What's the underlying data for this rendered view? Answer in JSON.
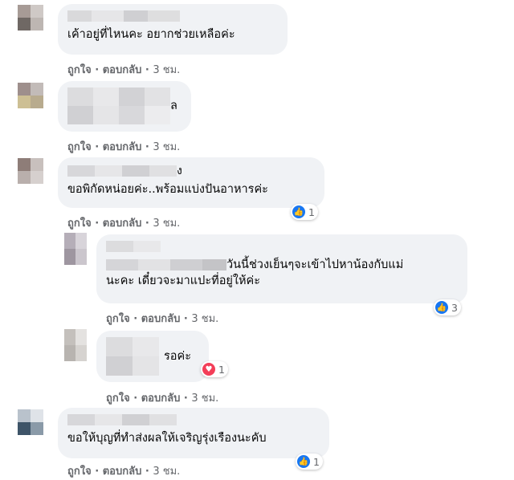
{
  "colors": {
    "bubble": "#f0f2f5",
    "meta": "#65676b",
    "like": "#1877f2",
    "love": "#f33e58"
  },
  "meta": {
    "like": "ถูกใจ",
    "reply": "ตอบกลับ",
    "sep": "·"
  },
  "comments": [
    {
      "text": "เค้าอยู่ที่ไหนคะ อยากช่วยเหลือค่ะ",
      "time": "3 ชม."
    },
    {
      "name_suffix": "ล",
      "time": "3 ชม."
    },
    {
      "name_suffix": "ง",
      "text": "ขอพิกัดหน่อยค่ะ..พร้อมแบ่งปันอาหารค่ะ",
      "time": "3 ชม.",
      "reaction": {
        "icon": "like-icon",
        "count": "1"
      }
    },
    {
      "text_line1": "วันนี้ช่วงเย็นๆจะเข้าไปหาน้องกับแม่",
      "text_line2": "นะคะ เดี๋ยวจะมาแปะที่อยู่ให้ค่ะ",
      "time": "3 ชม.",
      "reaction": {
        "icon": "like-icon",
        "count": "3"
      }
    },
    {
      "text": "รอค่ะ",
      "time": "3 ชม.",
      "reaction": {
        "icon": "love-icon",
        "count": "1"
      }
    },
    {
      "text": "ขอให้บุญที่ทำส่งผลให้เจริญรุ่งเรืองนะคับ",
      "time": "3 ชม.",
      "reaction": {
        "icon": "like-icon",
        "count": "1"
      }
    }
  ]
}
